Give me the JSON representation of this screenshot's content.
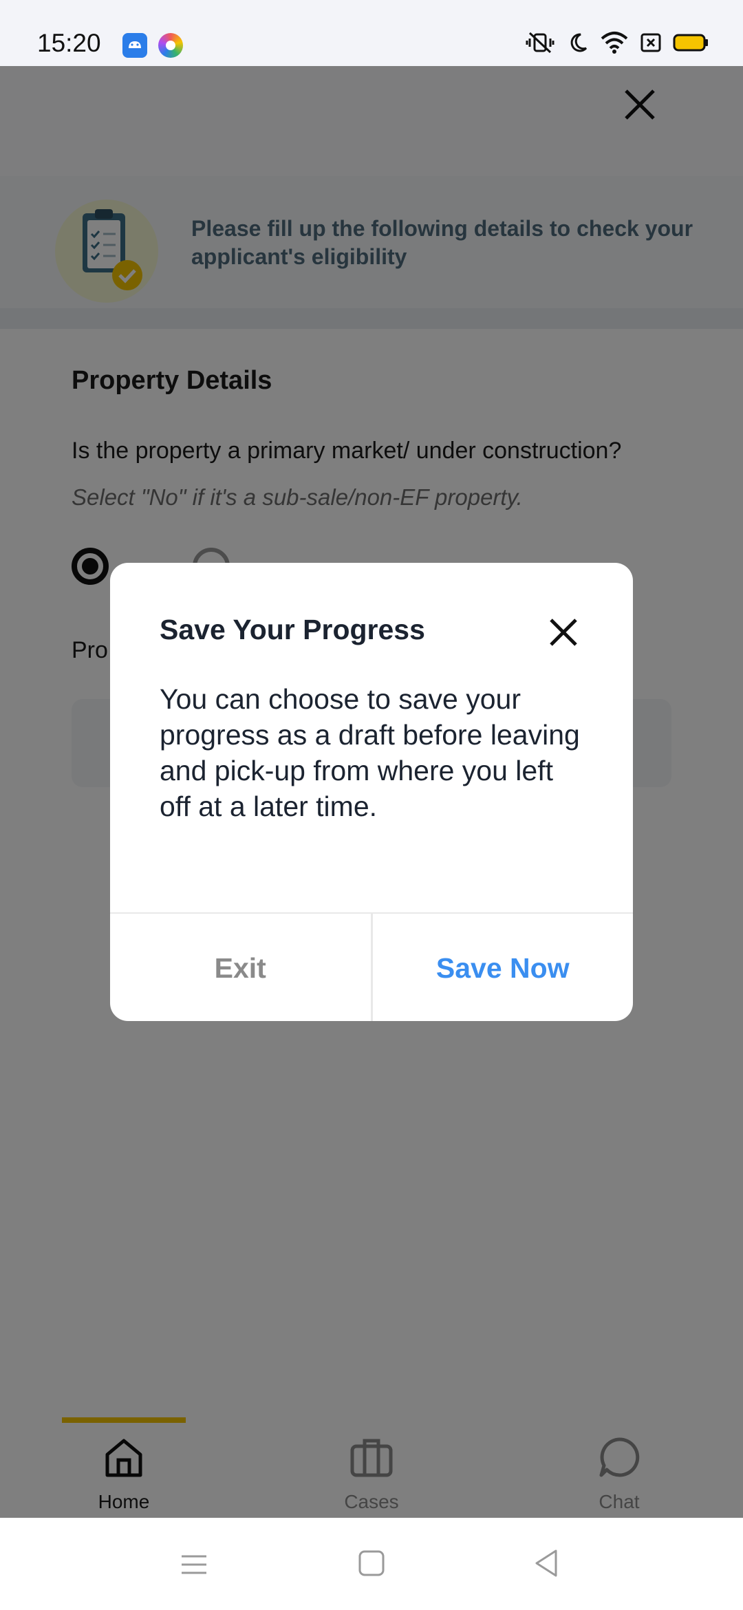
{
  "status_bar": {
    "time": "15:20",
    "icons": [
      "android-app-icon",
      "browser-app-icon",
      "vibrate-off-icon",
      "moon-icon",
      "wifi-icon",
      "sim-icon",
      "battery-icon"
    ],
    "battery_color": "#f5c400"
  },
  "header": {
    "close_icon": "close-icon"
  },
  "banner": {
    "icon": "clipboard-check-icon",
    "text": "Please fill up the following details to check your applicant's eligibility"
  },
  "form": {
    "section_title": "Property Details",
    "question": "Is the property a primary market/ under construction?",
    "hint": "Select \"No\" if it's a sub-sale/non-EF property.",
    "radio_yes_selected": true,
    "partial_label": "Pro"
  },
  "dialog": {
    "title": "Save Your Progress",
    "body": "You can choose to save your progress as a draft before leaving and pick-up from where you left off at a later time.",
    "exit_label": "Exit",
    "save_label": "Save Now",
    "accent": "#3a8ef0"
  },
  "bottom_nav": {
    "items": [
      {
        "label": "Home",
        "icon": "home-icon",
        "active": true
      },
      {
        "label": "Cases",
        "icon": "briefcase-icon",
        "active": false
      },
      {
        "label": "Chat",
        "icon": "chat-icon",
        "active": false
      }
    ],
    "active_color": "#f5c400"
  },
  "system_nav": {
    "icons": [
      "menu-icon",
      "home-square-icon",
      "back-icon"
    ]
  }
}
